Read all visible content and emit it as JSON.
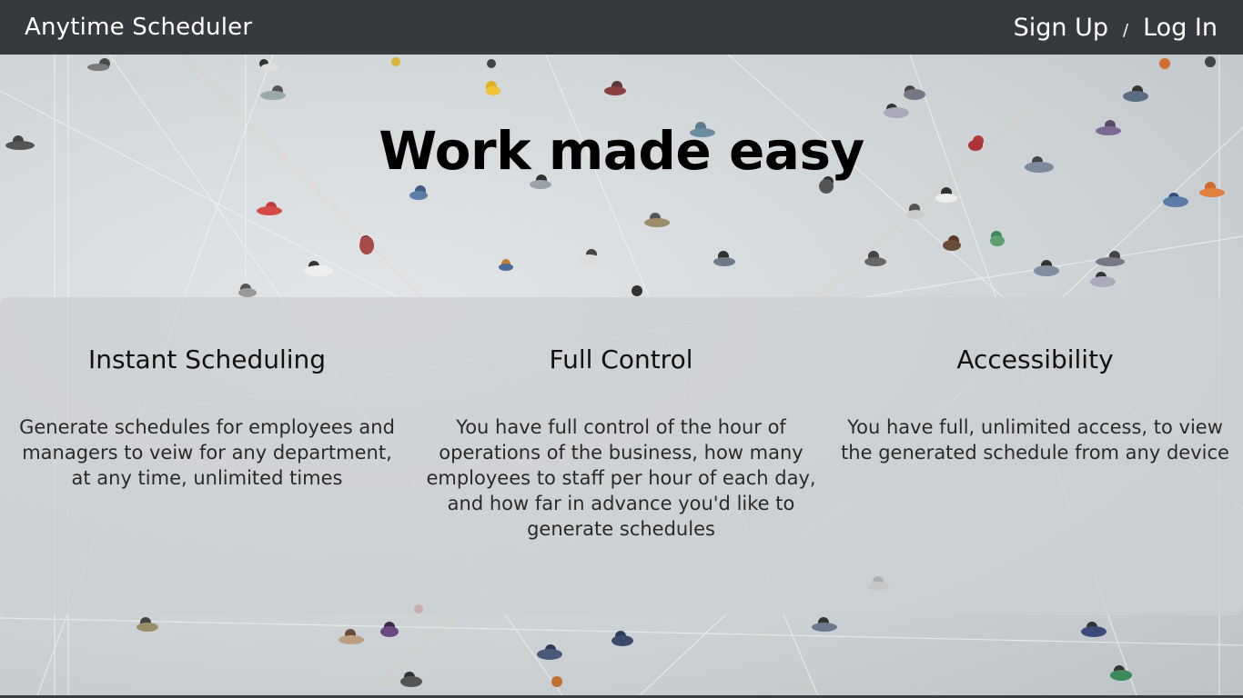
{
  "navbar": {
    "brand": "Anytime Scheduler",
    "signup_label": "Sign Up",
    "separator": "/",
    "login_label": "Log In"
  },
  "hero": {
    "title": "Work made easy"
  },
  "features": [
    {
      "title": "Instant Scheduling",
      "description": "Generate schedules for employees and managers to veiw for any department, at any time, unlimited times"
    },
    {
      "title": "Full Control",
      "description": "You have full control of the hour of operations of the business, how many employees to staff per hour of each day, and how far in advance you'd like to generate schedules"
    },
    {
      "title": "Accessibility",
      "description": "You have full, unlimited access, to view the generated schedule from any device"
    }
  ],
  "colors": {
    "navbar_bg": "#363a3f",
    "panel_bg": "rgba(205,208,210,0.78)",
    "text": "#000000"
  }
}
